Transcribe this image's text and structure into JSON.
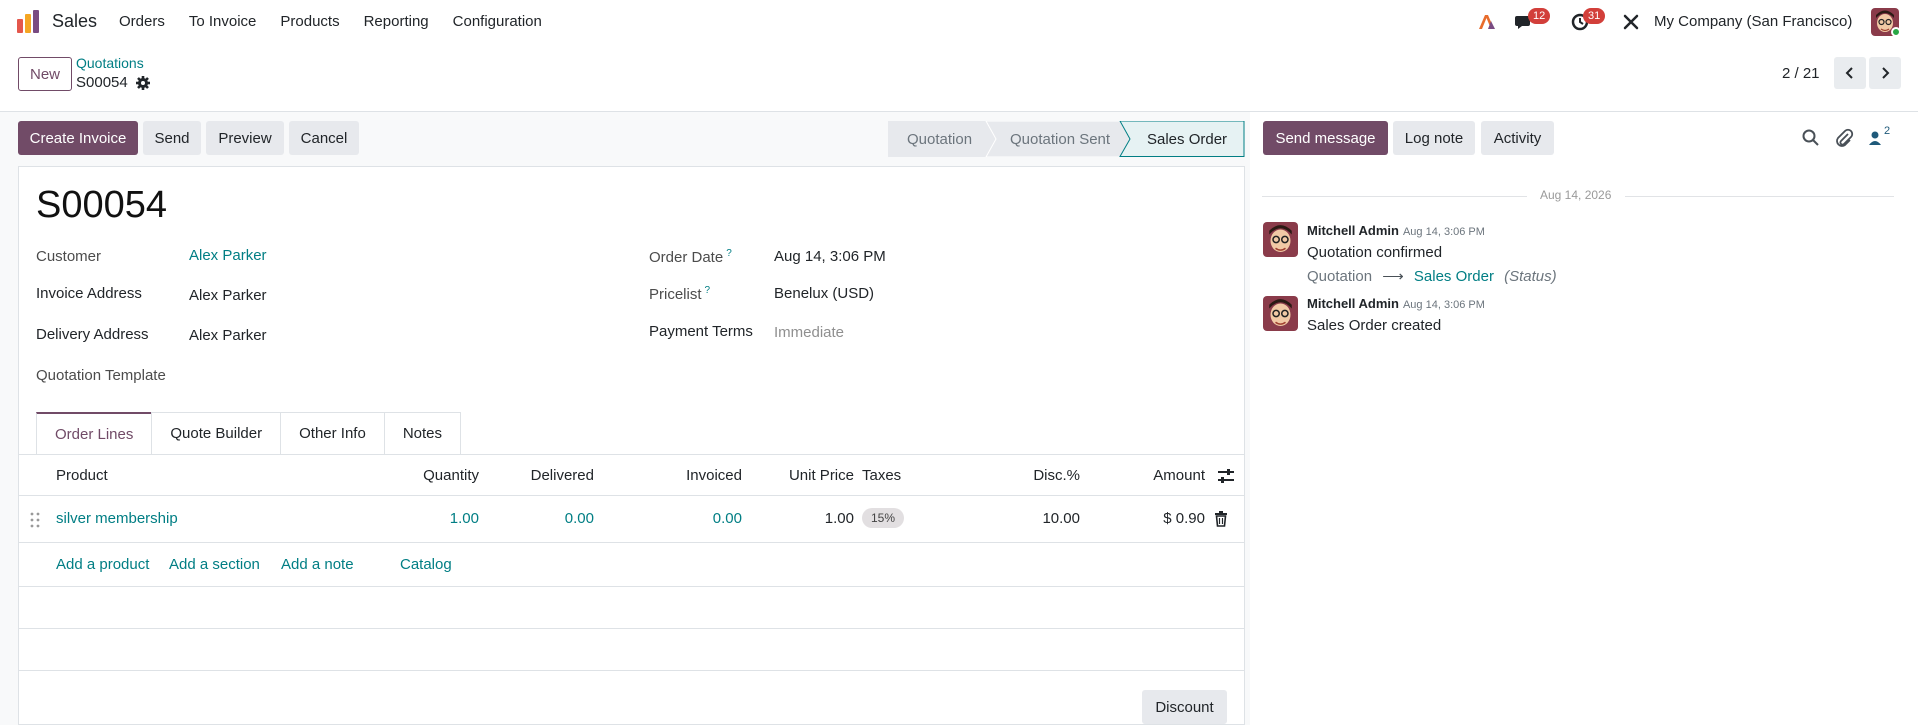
{
  "navbar": {
    "app_name": "Sales",
    "menu": [
      "Orders",
      "To Invoice",
      "Products",
      "Reporting",
      "Configuration"
    ],
    "messages_count": "12",
    "activities_count": "31",
    "company": "My Company (San Francisco)"
  },
  "control": {
    "new_label": "New",
    "breadcrumb_parent": "Quotations",
    "breadcrumb_current": "S00054",
    "pager": "2 / 21"
  },
  "actions": {
    "create_invoice": "Create Invoice",
    "send": "Send",
    "preview": "Preview",
    "cancel": "Cancel"
  },
  "stages": {
    "items": [
      "Quotation",
      "Quotation Sent",
      "Sales Order"
    ],
    "active": "Sales Order"
  },
  "chatter": {
    "send_message": "Send message",
    "log_note": "Log note",
    "activity": "Activity",
    "followers_count": "2",
    "date": "Aug 14, 2026",
    "messages": [
      {
        "author": "Mitchell Admin",
        "time": "Aug 14, 3:06 PM",
        "body": "Quotation confirmed",
        "track_old": "Quotation",
        "track_new": "Sales Order",
        "track_field": "(Status)"
      },
      {
        "author": "Mitchell Admin",
        "time": "Aug 14, 3:06 PM",
        "body": "Sales Order created"
      }
    ]
  },
  "form": {
    "name": "S00054",
    "customer_label": "Customer",
    "customer": "Alex Parker",
    "invoice_address_label": "Invoice Address",
    "invoice_address": "Alex Parker",
    "delivery_address_label": "Delivery Address",
    "delivery_address": "Alex Parker",
    "quotation_template_label": "Quotation Template",
    "order_date_label": "Order Date",
    "order_date": "Aug 14, 3:06 PM",
    "pricelist_label": "Pricelist",
    "pricelist": "Benelux (USD)",
    "payment_terms_label": "Payment Terms",
    "payment_terms_placeholder": "Immediate",
    "help_mark": "?"
  },
  "tabs": [
    "Order Lines",
    "Quote Builder",
    "Other Info",
    "Notes"
  ],
  "table": {
    "headers": {
      "product": "Product",
      "quantity": "Quantity",
      "delivered": "Delivered",
      "invoiced": "Invoiced",
      "unit_price": "Unit Price",
      "taxes": "Taxes",
      "disc": "Disc.%",
      "amount": "Amount"
    },
    "rows": [
      {
        "product": "silver membership",
        "quantity": "1.00",
        "delivered": "0.00",
        "invoiced": "0.00",
        "unit_price": "1.00",
        "tax": "15%",
        "disc": "10.00",
        "amount": "$ 0.90"
      }
    ],
    "add_product": "Add a product",
    "add_section": "Add a section",
    "add_note": "Add a note",
    "catalog": "Catalog"
  },
  "discount_label": "Discount"
}
